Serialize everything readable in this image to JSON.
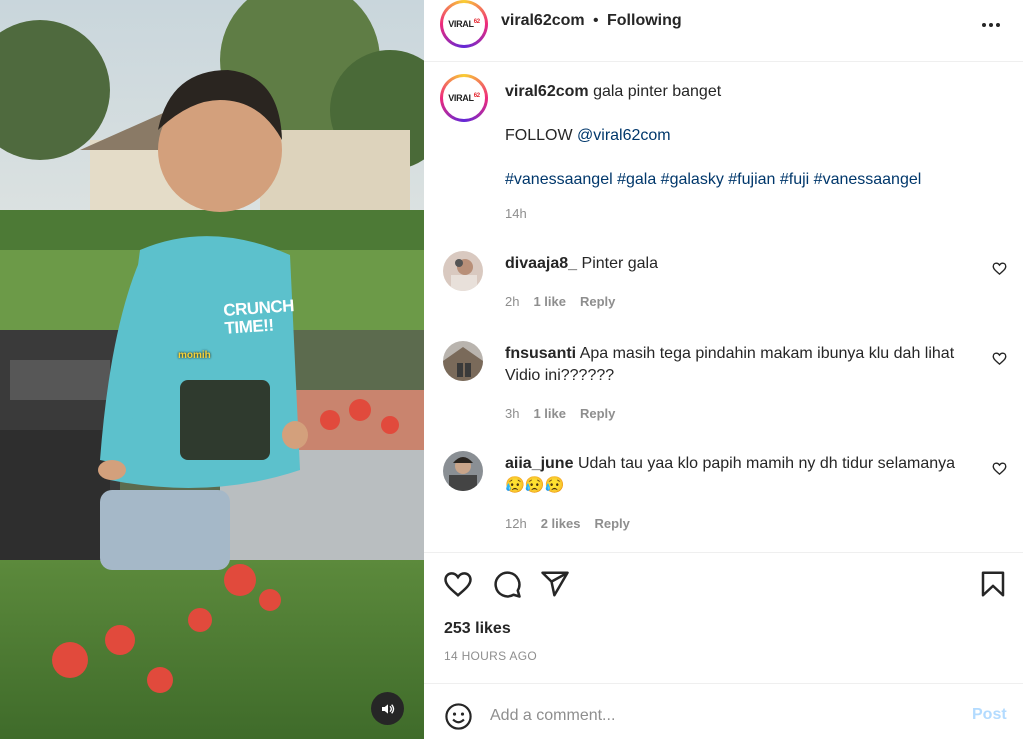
{
  "media": {
    "watermark": "momih",
    "shirt_text": "CRUNCH TIME!!",
    "audio_icon": "speaker-icon"
  },
  "header": {
    "avatar_brand": "VIRAL",
    "avatar_brand_suffix": "62",
    "username": "viral62com",
    "separator": "•",
    "follow_status": "Following",
    "more_icon": "more-horizontal-icon"
  },
  "caption": {
    "username": "viral62com",
    "text": "gala pinter banget",
    "follow_prefix": "FOLLOW ",
    "follow_handle": "@viral62com",
    "hashtags": "#vanessaangel #gala #galasky #fujian #fuji #vanessaangel",
    "time": "14h"
  },
  "comments": [
    {
      "username": "divaaja8_",
      "text": "Pinter gala",
      "time": "2h",
      "likes": "1 like",
      "reply": "Reply"
    },
    {
      "username": "fnsusanti",
      "text": "Apa masih tega pindahin makam ibunya klu dah lihat Vidio ini??????",
      "time": "3h",
      "likes": "1 like",
      "reply": "Reply"
    },
    {
      "username": "aiia_june",
      "text": "Udah tau yaa klo papih mamih ny dh tidur selamanya",
      "time": "12h",
      "likes": "2 likes",
      "reply": "Reply",
      "emoji": "😥😥😥"
    }
  ],
  "actions": {
    "like_icon": "heart-icon",
    "comment_icon": "comment-icon",
    "share_icon": "share-icon",
    "save_icon": "bookmark-icon",
    "likes": "253 likes",
    "posted": "14 HOURS AGO"
  },
  "comment_box": {
    "placeholder": "Add a comment...",
    "post_label": "Post",
    "emoji_icon": "emoji-icon"
  },
  "colors": {
    "link": "#00376b",
    "muted": "#8e8e8e",
    "post_disabled": "#b3dbff"
  }
}
